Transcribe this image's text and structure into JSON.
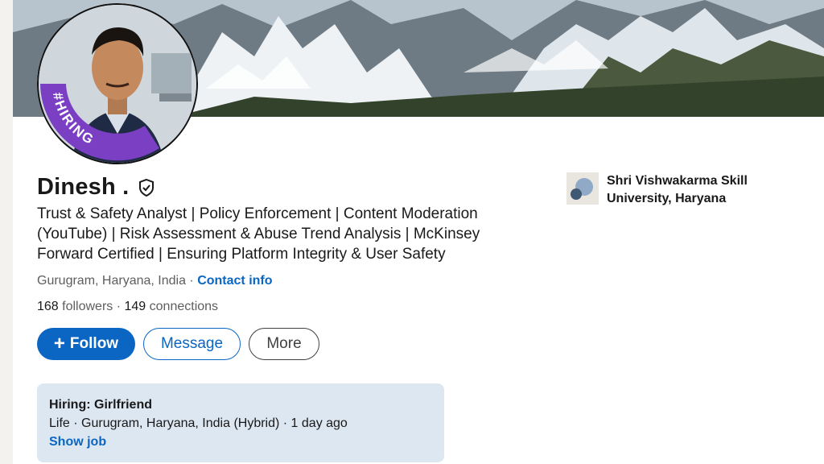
{
  "profile": {
    "name": "Dinesh .",
    "headline": "Trust & Safety Analyst | Policy Enforcement | Content Moderation (YouTube) | Risk Assessment & Abuse Trend Analysis | McKinsey Forward Certified | Ensuring Platform Integrity & User Safety",
    "location": "Gurugram, Haryana, India",
    "location_sep": " · ",
    "contact_info": "Contact info",
    "followers_count": "168",
    "followers_label": " followers",
    "connections_sep": " · ",
    "connections_count": "149",
    "connections_label": " connections",
    "open_to_work_badge": "#HIRING"
  },
  "actions": {
    "follow_plus": "+",
    "follow_label": "Follow",
    "message_label": "Message",
    "more_label": "More"
  },
  "education": {
    "school": "Shri Vishwakarma Skill University, Haryana"
  },
  "hiring": {
    "title": "Hiring: Girlfriend",
    "meta": "Life · Gurugram, Haryana, India (Hybrid) · 1 day ago",
    "link": "Show job"
  },
  "colors": {
    "accent": "#0a66c2",
    "hiring_ring": "#7b3fc4",
    "hiring_box_bg": "#dde7f1"
  },
  "icons": {
    "verified": "shield-check-icon",
    "school_logo": "school-logo"
  }
}
